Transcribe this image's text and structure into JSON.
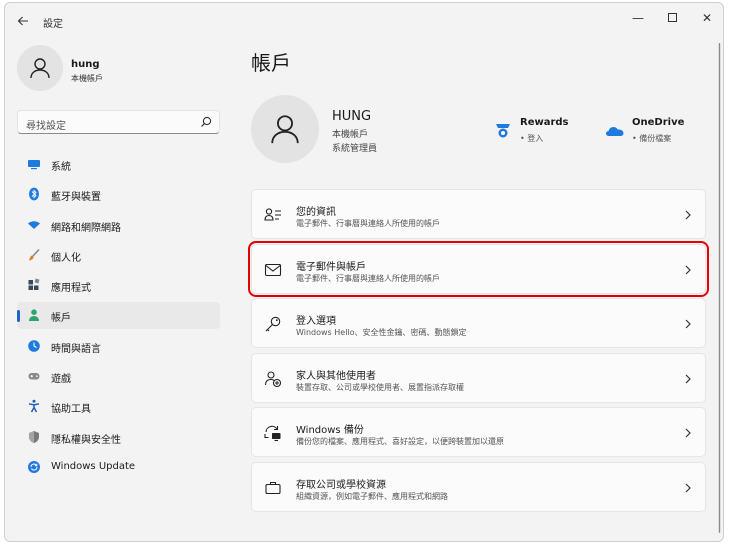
{
  "window": {
    "title": "設定",
    "back_icon": "arrow-left-icon"
  },
  "window_controls": {
    "minimize": "—",
    "close": "✕"
  },
  "user": {
    "name": "hung",
    "type": "本機帳戶"
  },
  "search": {
    "placeholder": "尋找設定"
  },
  "sidebar": {
    "items": [
      {
        "label": "系統",
        "icon": "monitor-icon",
        "color": "#1f7ae0"
      },
      {
        "label": "藍牙與裝置",
        "icon": "bluetooth-icon",
        "color": "#1f7ae0"
      },
      {
        "label": "網路和網際網路",
        "icon": "wifi-icon",
        "color": "#1f7ae0"
      },
      {
        "label": "個人化",
        "icon": "paintbrush-icon",
        "color": "#d9822b"
      },
      {
        "label": "應用程式",
        "icon": "apps-icon",
        "color": "#3a4a5c"
      },
      {
        "label": "帳戶",
        "icon": "person-icon",
        "color": "#2fa36b",
        "selected": true
      },
      {
        "label": "時間與語言",
        "icon": "globe-clock-icon",
        "color": "#1f7ae0"
      },
      {
        "label": "遊戲",
        "icon": "gamepad-icon",
        "color": "#6b6b6b"
      },
      {
        "label": "協助工具",
        "icon": "accessibility-icon",
        "color": "#1f5fb5"
      },
      {
        "label": "隱私權與安全性",
        "icon": "shield-icon",
        "color": "#6b6b6b"
      },
      {
        "label": "Windows Update",
        "icon": "update-icon",
        "color": "#1f7ae0"
      }
    ]
  },
  "main": {
    "title": "帳戶",
    "account": {
      "name": "HUNG",
      "line1": "本機帳戶",
      "line2": "系統管理員"
    },
    "services": [
      {
        "name": "Rewards",
        "status": "• 登入",
        "icon": "rewards-icon",
        "color": "#1f7ae0"
      },
      {
        "name": "OneDrive",
        "status": "• 備份檔案",
        "icon": "onedrive-icon",
        "color": "#1f7ae0"
      }
    ],
    "cards": [
      {
        "title": "您的資訊",
        "desc": "電子郵件、行事曆與連絡人所使用的帳戶",
        "icon": "person-info-icon"
      },
      {
        "title": "電子郵件與帳戶",
        "desc": "電子郵件、行事曆與連絡人所使用的帳戶",
        "icon": "mail-icon",
        "highlighted": true
      },
      {
        "title": "登入選項",
        "desc": "Windows Hello、安全性金鑰、密碼、動態鎖定",
        "icon": "key-icon"
      },
      {
        "title": "家人與其他使用者",
        "desc": "裝置存取、公司或學校使用者、展置指派存取權",
        "icon": "family-icon"
      },
      {
        "title": "Windows 備份",
        "desc": "備份您的檔案、應用程式、喜好設定，以便跨裝置加以還原",
        "icon": "backup-icon"
      },
      {
        "title": "存取公司或學校資源",
        "desc": "組織資源，例如電子郵件、應用程式和網路",
        "icon": "briefcase-icon"
      }
    ]
  }
}
